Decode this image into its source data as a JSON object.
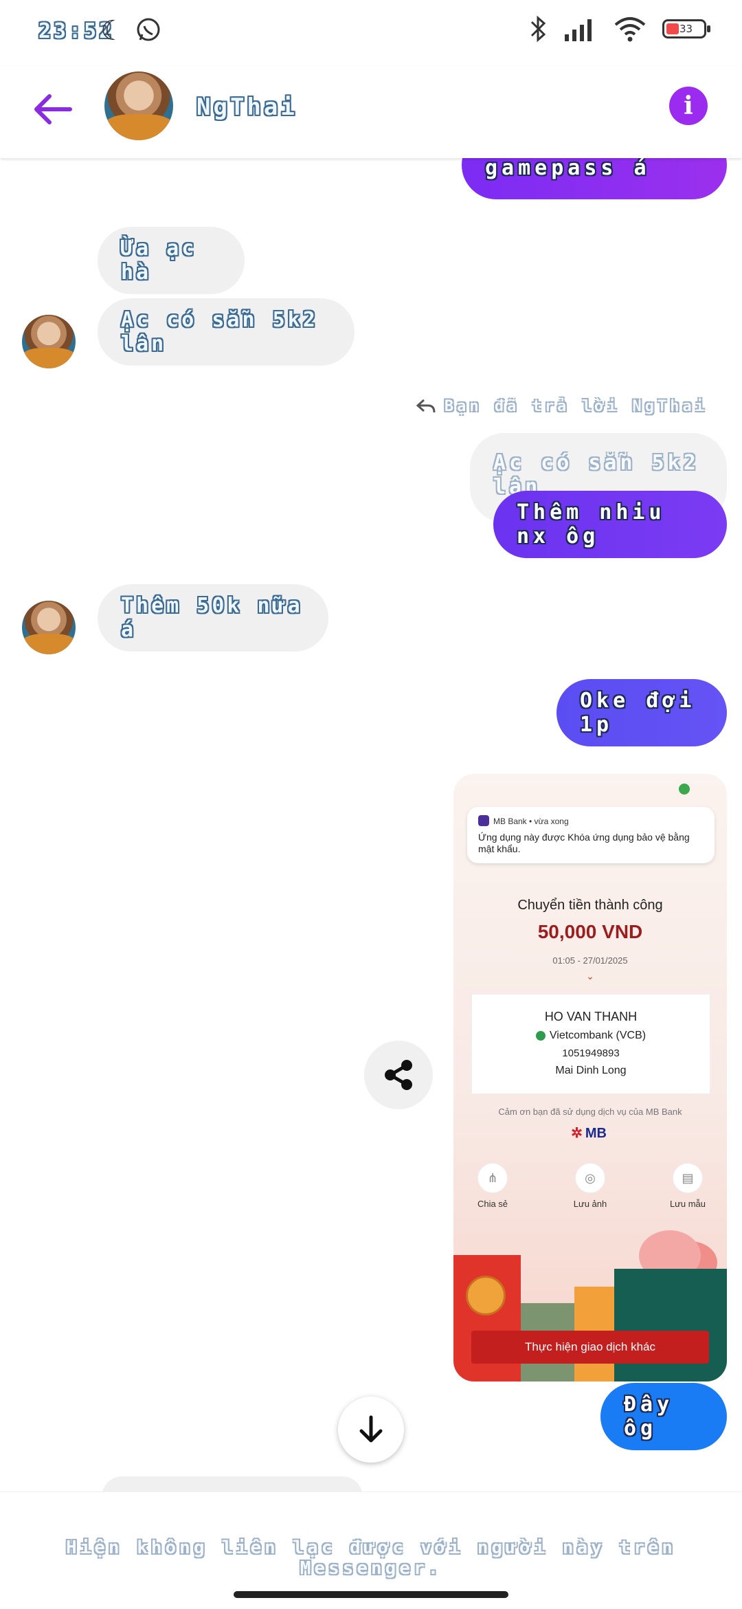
{
  "status_bar": {
    "time": "23:52",
    "battery": "33"
  },
  "header": {
    "contact_name": "NgThai"
  },
  "messages": [
    {
      "text": "Tui lấy gamepass á",
      "side": "out"
    },
    {
      "text": "Ừa ạc hà",
      "side": "in"
    },
    {
      "text": "Ạc có sẵn 5k2 lân",
      "side": "in"
    },
    {
      "text": "Thêm nhiu nx ôg",
      "side": "out"
    },
    {
      "text": "Thêm 50k nữa á",
      "side": "in"
    },
    {
      "text": "Oke đợi 1p",
      "side": "out"
    },
    {
      "text": "Đây ôg",
      "side": "out"
    }
  ],
  "reply": {
    "note": "Bạn đã trả lời NgThai",
    "quoted": "Ạc có sẵn 5k2 lân"
  },
  "attachment": {
    "notif_app": "MB Bank • vừa xong",
    "notif_msg": "Ứng dụng này được Khóa ứng dụng bảo vệ bằng mật khẩu.",
    "title": "Chuyển tiền thành công",
    "amount": "50,000 VND",
    "date": "01:05 - 27/01/2025",
    "recipient": "HO VAN THANH",
    "bank": "Vietcombank (VCB)",
    "account": "1051949893",
    "branch": "Mai Dinh Long",
    "thanks": "Cảm ơn bạn đã sử dụng dịch vụ của MB Bank",
    "brand": "MB",
    "actions": [
      "Chia sẻ",
      "Lưu ảnh",
      "Lưu mẫu"
    ],
    "cta": "Thực hiện giao dịch khác"
  },
  "footer": {
    "note": "Hiện không liên lạc được với người này trên Messenger."
  },
  "colors": {
    "accent": "#9c2bf0",
    "bubble_in": "#f0f0f0",
    "last_bubble": "#1a7cf5"
  }
}
